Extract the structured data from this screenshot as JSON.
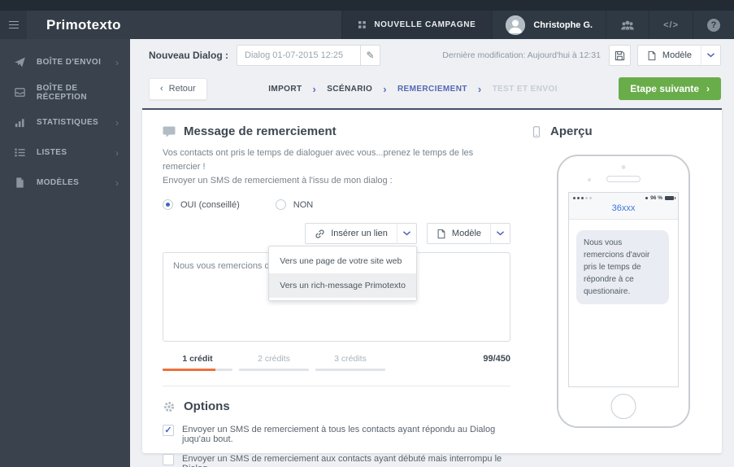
{
  "colors": {
    "accent_blue": "#5368b4",
    "link_blue": "#3f74dd",
    "green": "#69ad4a",
    "orange": "#f0703c",
    "navbar_bg": "#353e48",
    "sidebar_bg": "#3a434d",
    "card_top_border": "#44516b"
  },
  "icons": {
    "back_chevron": "‹",
    "next_chevron": "›",
    "step_separator": "›",
    "item_chevron": "›",
    "pencil": "✎",
    "code": "</>",
    "help": "?",
    "check": "✓"
  },
  "navbar": {
    "logo": "Primotexto",
    "new_campaign": "NOUVELLE CAMPAGNE",
    "user_name": "Christophe G."
  },
  "sidebar": {
    "items": [
      {
        "label": "BOÎTE D'ENVOI",
        "icon": "paper-plane-icon",
        "has_submenu": true
      },
      {
        "label": "BOÎTE DE RÉCEPTION",
        "icon": "inbox-icon",
        "has_submenu": false
      },
      {
        "label": "STATISTIQUES",
        "icon": "bar-chart-icon",
        "has_submenu": true
      },
      {
        "label": "LISTES",
        "icon": "list-icon",
        "has_submenu": true
      },
      {
        "label": "MODÈLES",
        "icon": "file-icon",
        "has_submenu": true
      }
    ]
  },
  "topbar": {
    "label": "Nouveau Dialog :",
    "dialog_name": "Dialog 01-07-2015 12:25",
    "last_modified": "Dernière modification: Aujourd'hui à 12:31",
    "model_button": "Modèle"
  },
  "steps": {
    "back": "Retour",
    "next": "Etape suivante",
    "items": [
      {
        "label": "IMPORT",
        "state": "done"
      },
      {
        "label": "SCÉNARIO",
        "state": "done"
      },
      {
        "label": "REMERCIEMENT",
        "state": "active"
      },
      {
        "label": "TEST ET ENVOI",
        "state": "upcoming"
      }
    ]
  },
  "message": {
    "title": "Message de remerciement",
    "intro_line1": "Vos contacts ont pris le temps de dialoguer avec vous...prenez le temps de les remercier !",
    "intro_line2": "Envoyer un SMS de remerciement à l'issu de mon dialog :",
    "radio_yes": "OUI (conseillé)",
    "radio_no": "NON",
    "insert_link": "Insérer un lien",
    "model_button": "Modèle",
    "dropdown": [
      {
        "label": "Vers une page de votre site web",
        "highlighted": false
      },
      {
        "label": "Vers un rich-message Primotexto",
        "highlighted": true
      }
    ],
    "textarea_value": "Nous vous remercions d'avoir pris le temps de répond",
    "credits": [
      {
        "label": "1 crédit",
        "active": true
      },
      {
        "label": "2 crédits",
        "active": false
      },
      {
        "label": "3 crédits",
        "active": false
      }
    ],
    "counter": "99/450"
  },
  "options": {
    "title": "Options",
    "items": [
      {
        "label": "Envoyer un SMS de remerciement à tous les contacts ayant répondu au Dialog juqu'au bout.",
        "checked": true
      },
      {
        "label": "Envoyer un SMS de remerciement aux contacts ayant débuté mais interrompu le Dialog.",
        "checked": false
      }
    ]
  },
  "preview": {
    "title": "Aperçu",
    "sender": "36xxx",
    "battery": "96 %",
    "bubble": "Nous vous remercions d'avoir pris le temps de répondre à ce questionaire."
  }
}
